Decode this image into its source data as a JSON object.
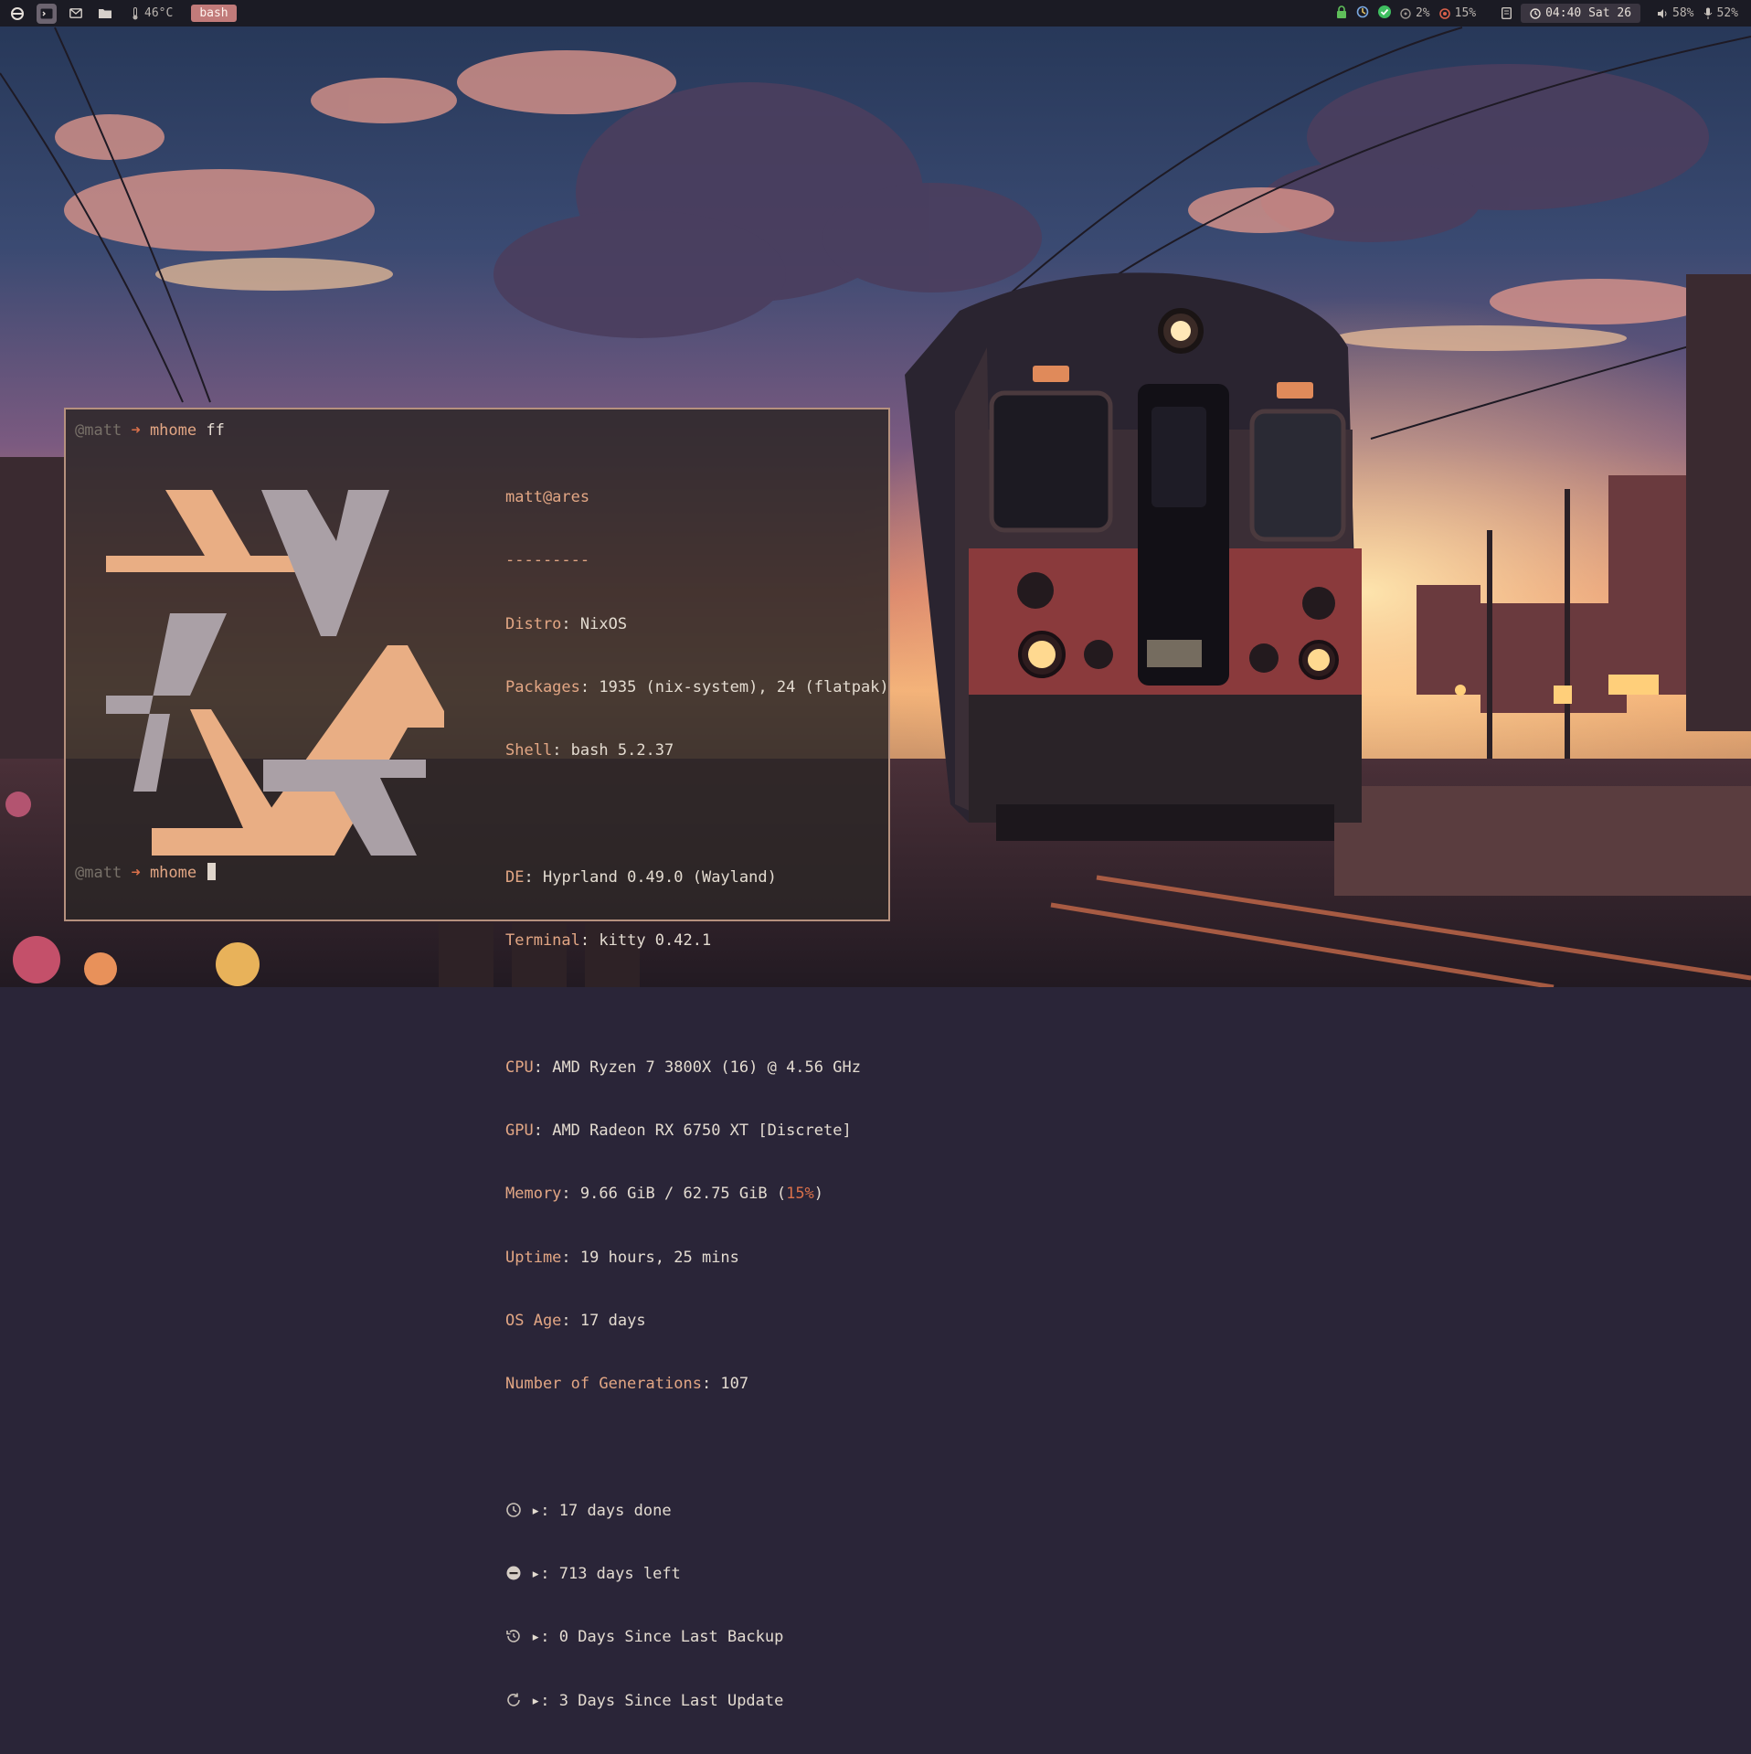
{
  "topbar": {
    "temperature": "46°C",
    "active_window": "bash",
    "status_cpu": "2%",
    "status_mem": "15%",
    "clock": "04:40 Sat 26",
    "volume": "58%",
    "mic": "52%"
  },
  "terminal": {
    "prompt_user": "@matt",
    "prompt_arrow": "➜",
    "prompt_dir": "mhome",
    "command": "ff",
    "user_host": "matt@ares",
    "separator": "---------",
    "info": [
      {
        "key": "Distro",
        "value": "NixOS"
      },
      {
        "key": "Packages",
        "value": "1935 (nix-system), 24 (flatpak)"
      },
      {
        "key": "Shell",
        "value": "bash 5.2.37"
      },
      {
        "key": "DE",
        "value": "Hyprland 0.49.0 (Wayland)"
      },
      {
        "key": "Terminal",
        "value": "kitty 0.42.1"
      },
      {
        "key": "CPU",
        "value": "AMD Ryzen 7 3800X (16) @ 4.56 GHz"
      },
      {
        "key": "GPU",
        "value": "AMD Radeon RX 6750 XT [Discrete]"
      },
      {
        "key": "Memory",
        "value_prefix": "9.66 GiB / 62.75 GiB (",
        "value_pct": "15%",
        "value_suffix": ")"
      },
      {
        "key": "Uptime",
        "value": "19 hours, 25 mins"
      },
      {
        "key": "OS Age",
        "value": "17 days"
      },
      {
        "key": "Number of Generations",
        "value": "107"
      }
    ],
    "countdowns": [
      {
        "icon": "clock-icon",
        "marker": "▸:",
        "text": "17 days done"
      },
      {
        "icon": "minus-circle-icon",
        "marker": "▸:",
        "text": "713 days left"
      },
      {
        "icon": "history-icon",
        "marker": "▸:",
        "text": "0 Days Since Last Backup"
      },
      {
        "icon": "refresh-icon",
        "marker": "▸:",
        "text": "3 Days Since Last Update"
      }
    ]
  },
  "colors": {
    "accent": "#e2a684",
    "arrow": "#d9704a",
    "logo_peach": "#e9ae84",
    "logo_grey": "#aaa0a6",
    "border": "#b6917e",
    "active_title": "#c17b7a"
  }
}
